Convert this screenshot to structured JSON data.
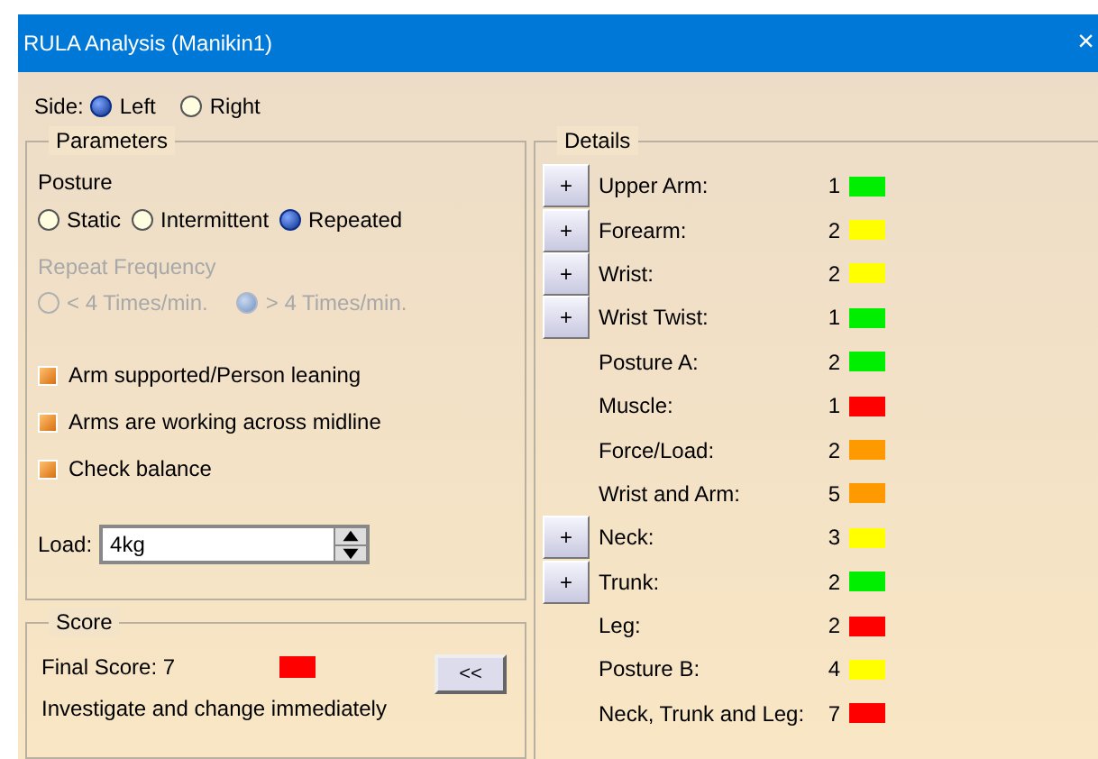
{
  "window": {
    "title": "RULA Analysis (Manikin1)",
    "close": "×"
  },
  "side": {
    "label": "Side:",
    "options": [
      {
        "label": "Left",
        "selected": true
      },
      {
        "label": "Right",
        "selected": false
      }
    ]
  },
  "parameters": {
    "title": "Parameters",
    "posture": {
      "label": "Posture",
      "options": [
        {
          "label": "Static",
          "selected": false
        },
        {
          "label": "Intermittent",
          "selected": false
        },
        {
          "label": "Repeated",
          "selected": true
        }
      ]
    },
    "repeat_frequency": {
      "label": "Repeat Frequency",
      "disabled": true,
      "options": [
        {
          "label": "< 4 Times/min.",
          "selected": false
        },
        {
          "label": "> 4 Times/min.",
          "selected": true
        }
      ]
    },
    "checks": [
      {
        "label": "Arm supported/Person leaning",
        "checked": true
      },
      {
        "label": "Arms are working across midline",
        "checked": true
      },
      {
        "label": "Check balance",
        "checked": true
      }
    ],
    "load": {
      "label": "Load:",
      "value": "4kg"
    }
  },
  "score": {
    "title": "Score",
    "final": "Final Score: 7",
    "color": "#ff0000",
    "message": "Investigate and change immediately",
    "button": "<<"
  },
  "details": {
    "title": "Details",
    "rows": [
      {
        "expand": "+",
        "label": "Upper Arm:",
        "value": "1",
        "color": "#00ee00"
      },
      {
        "expand": "+",
        "label": "Forearm:",
        "value": "2",
        "color": "#ffff00"
      },
      {
        "expand": "+",
        "label": "Wrist:",
        "value": "2",
        "color": "#ffff00"
      },
      {
        "expand": "+",
        "label": "Wrist Twist:",
        "value": "1",
        "color": "#00ee00"
      },
      {
        "label": "Posture A:",
        "value": "2",
        "color": "#00ee00"
      },
      {
        "label": "Muscle:",
        "value": "1",
        "color": "#ff0000"
      },
      {
        "label": "Force/Load:",
        "value": "2",
        "color": "#ff9900"
      },
      {
        "label": "Wrist and Arm:",
        "value": "5",
        "color": "#ff9900"
      },
      {
        "expand": "+",
        "label": "Neck:",
        "value": "3",
        "color": "#ffff00"
      },
      {
        "expand": "+",
        "label": "Trunk:",
        "value": "2",
        "color": "#00ee00"
      },
      {
        "label": "Leg:",
        "value": "2",
        "color": "#ff0000"
      },
      {
        "label": "Posture B:",
        "value": "4",
        "color": "#ffff00"
      },
      {
        "label": "Neck, Trunk and Leg:",
        "value": "7",
        "color": "#ff0000"
      }
    ]
  }
}
